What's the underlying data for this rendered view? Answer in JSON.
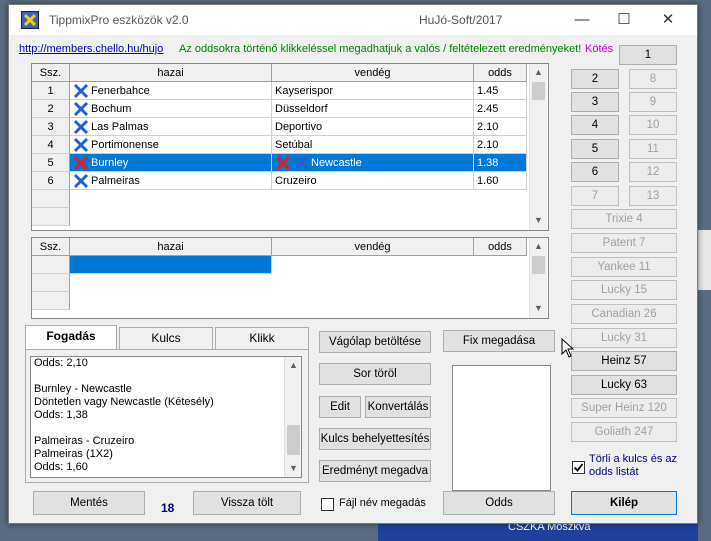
{
  "window": {
    "title": "TippmixPro eszközök  v2.0",
    "subtitle": "HuJó-Soft/2017",
    "minimize": "—",
    "maximize": "☐",
    "close": "✕"
  },
  "header": {
    "link": "http://members.chello.hu/hujo",
    "hint": "Az oddsokra történő klikkeléssel megadhatjuk a valós /  feltételezett eredményeket!",
    "kotes": "Kötés"
  },
  "grid_top": {
    "columns": [
      "Ssz.",
      "hazai",
      "vendég",
      "odds"
    ],
    "rows": [
      {
        "n": "1",
        "home": "Fenerbahce",
        "away": "Kayserispor",
        "odds": "1.45"
      },
      {
        "n": "2",
        "home": "Bochum",
        "away": "Düsseldorf",
        "odds": "2.45"
      },
      {
        "n": "3",
        "home": "Las Palmas",
        "away": "Deportivo",
        "odds": "2.10"
      },
      {
        "n": "4",
        "home": "Portimonense",
        "away": "Setúbal",
        "odds": "2.10"
      },
      {
        "n": "5",
        "home": "Burnley",
        "away": "Newcastle",
        "odds": "1.38"
      },
      {
        "n": "6",
        "home": "Palmeiras",
        "away": "Cruzeiro",
        "odds": "1.60"
      }
    ]
  },
  "grid_bottom": {
    "columns": [
      "Ssz.",
      "hazai",
      "vendég",
      "odds"
    ]
  },
  "number_buttons": [
    "1",
    "2",
    "3",
    "4",
    "5",
    "6",
    "7",
    "8",
    "9",
    "10",
    "11",
    "12",
    "13"
  ],
  "system_buttons": [
    "Trixie 4",
    "Patent 7",
    "Yankee 11",
    "Lucky 15",
    "Canadian 26",
    "Lucky 31",
    "Heinz 57",
    "Lucky 63",
    "Super Heinz 120",
    "Goliath 247"
  ],
  "tabs": [
    "Fogadás",
    "Kulcs",
    "Klikk"
  ],
  "memo": [
    "Odds: 2,10",
    "",
    "Burnley - Newcastle",
    "Döntetlen vagy Newcastle (Kétesély)",
    "Odds: 1,38",
    "",
    "Palmeiras - Cruzeiro",
    "Palmeiras (1X2)",
    "Odds: 1,60"
  ],
  "actions": {
    "vagolap": "Vágólap betöltése",
    "fix": "Fix megadása",
    "sortorol": "Sor töröl",
    "edit": "Edit",
    "konvertalas": "Konvertálás",
    "kulcs": "Kulcs behelyettesítés",
    "eredmeny": "Eredményt megadva",
    "mentes": "Mentés",
    "count": "18",
    "visszatolt": "Vissza tölt",
    "fajlnev": "Fájl név megadás",
    "odds": "Odds",
    "kilep": "Kilép",
    "torli": "Törli a kulcs és az odds listát"
  },
  "background": {
    "text": "CSZKA Moszkva"
  },
  "colors": {
    "selection": "#0078d7",
    "link": "#0000cc",
    "hint": "#008000",
    "kotes": "#cc00cc"
  }
}
